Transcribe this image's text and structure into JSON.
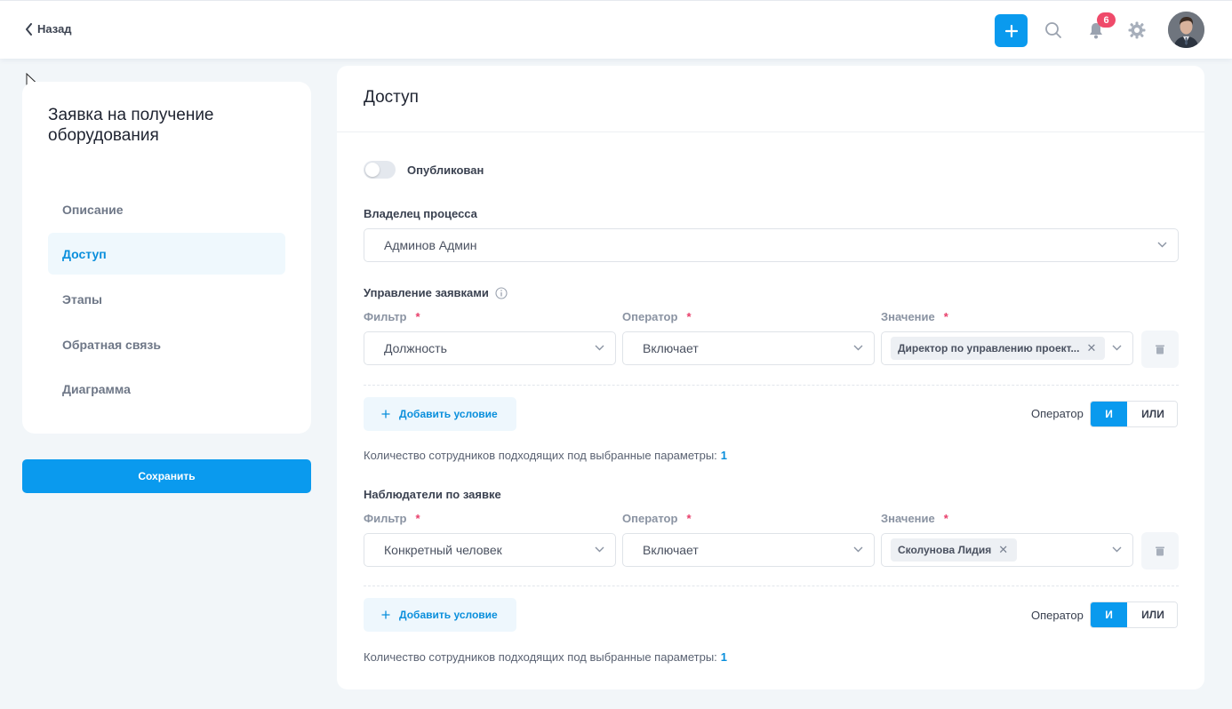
{
  "header": {
    "back_label": "Назад",
    "notifications_count": "6",
    "icons": [
      "plus-icon",
      "search-icon",
      "bell-icon",
      "gear-icon"
    ]
  },
  "sidebar": {
    "title": "Заявка на получение оборудования",
    "items": [
      {
        "label": "Описание",
        "active": false
      },
      {
        "label": "Доступ",
        "active": true
      },
      {
        "label": "Этапы",
        "active": false
      },
      {
        "label": "Обратная связь",
        "active": false
      },
      {
        "label": "Диаграмма",
        "active": false
      }
    ],
    "save_label": "Сохранить"
  },
  "main": {
    "title": "Доступ",
    "published_label": "Опубликован",
    "published": false,
    "owner": {
      "label": "Владелец процесса",
      "value": "Админов Админ"
    },
    "management": {
      "label": "Управление заявками",
      "filter_label": "Фильтр",
      "operator_label": "Оператор",
      "value_label": "Значение",
      "required_mark": "*",
      "filter_value": "Должность",
      "operator_value": "Включает",
      "value_tag": "Директор по управлению проект...",
      "add_condition": "Добавить условие",
      "logic_label": "Оператор",
      "logic_and": "И",
      "logic_or": "ИЛИ",
      "count_text": "Количество сотрудников подходящих под выбранные параметры:",
      "count_value": "1"
    },
    "observers": {
      "label": "Наблюдатели по заявке",
      "filter_label": "Фильтр",
      "operator_label": "Оператор",
      "value_label": "Значение",
      "required_mark": "*",
      "filter_value": "Конкретный человек",
      "operator_value": "Включает",
      "value_tag": "Сколунова Лидия",
      "add_condition": "Добавить условие",
      "logic_label": "Оператор",
      "logic_and": "И",
      "logic_or": "ИЛИ",
      "count_text": "Количество сотрудников подходящих под выбранные параметры:",
      "count_value": "1"
    }
  },
  "colors": {
    "accent": "#0a9aee",
    "required": "#e83e6a",
    "badge": "#ef4a6a"
  }
}
